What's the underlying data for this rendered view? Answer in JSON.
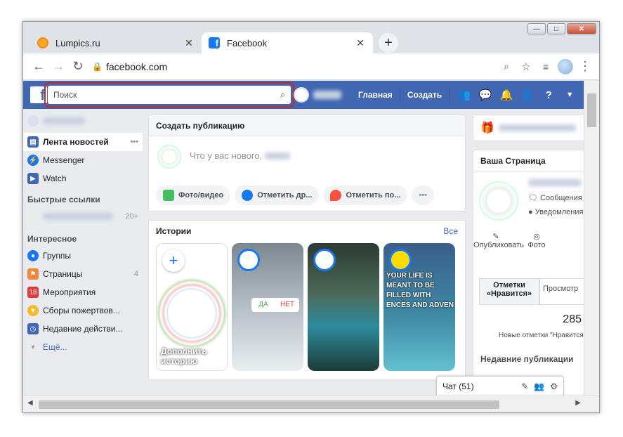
{
  "browser": {
    "tabs": [
      {
        "title": "Lumpics.ru",
        "active": false
      },
      {
        "title": "Facebook",
        "active": true
      }
    ],
    "new_tab": "+",
    "address": "facebook.com"
  },
  "fb": {
    "search_placeholder": "Поиск",
    "nav": {
      "home": "Главная",
      "create": "Создать"
    },
    "left": {
      "news_feed": "Лента новостей",
      "messenger": "Messenger",
      "watch": "Watch",
      "shortcuts_title": "Быстрые ссылки",
      "shortcut_count": "20+",
      "explore_title": "Интересное",
      "groups": "Группы",
      "pages": "Страницы",
      "pages_count": "4",
      "events": "Мероприятия",
      "fundraisers": "Сборы пожертвов...",
      "recent": "Недавние действи...",
      "more": "Ещё..."
    },
    "composer": {
      "title": "Создать публикацию",
      "prompt": "Что у вас нового,",
      "photo": "Фото/видео",
      "tag": "Отметить др...",
      "checkin": "Отметить по...",
      "more": "•••"
    },
    "stories": {
      "title": "Истории",
      "all": "Все",
      "add": "Дополнить историю",
      "poll_yes": "ДА",
      "poll_no": "НЕТ",
      "quote": "YOUR LIFE IS MEANT TO BE FILLED WITH ENCES AND ADVEN"
    },
    "right": {
      "your_page": "Ваша Страница",
      "messages": "Сообщения",
      "notifications": "Уведомления",
      "publish": "Опубликовать",
      "photo": "Фото",
      "likes_tab": "Отметки «Нравится»",
      "views_tab": "Просмотр",
      "likes_count": "285",
      "new_likes": "Новые отметки \"Нравится\"",
      "recent_posts": "Недавние публикации"
    },
    "chat": {
      "label": "Чат (51)"
    }
  }
}
